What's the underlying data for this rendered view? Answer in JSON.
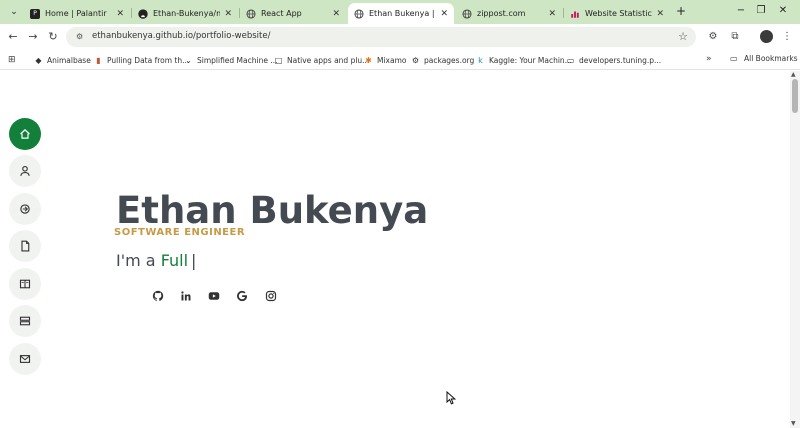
{
  "browser": {
    "tabs": [
      {
        "label": "Home | Palantir",
        "favicon": "palantir-icon",
        "active": false
      },
      {
        "label": "Ethan-Bukenya/memo",
        "favicon": "github-icon",
        "active": false
      },
      {
        "label": "React App",
        "favicon": "globe-icon",
        "active": false
      },
      {
        "label": "Ethan Bukenya | Portf",
        "favicon": "globe-icon",
        "active": true
      },
      {
        "label": "zippost.com",
        "favicon": "globe-icon",
        "active": false
      },
      {
        "label": "Website Statistics",
        "favicon": "stats-icon",
        "active": false
      }
    ],
    "address": "ethanbukenya.github.io/portfolio-website/",
    "bookmarks": [
      {
        "label": "Animalbase",
        "icon": "animal-icon"
      },
      {
        "label": "Pulling Data from th...",
        "icon": "page-icon"
      },
      {
        "label": "Simplified Machine ...",
        "icon": "chevron-icon"
      },
      {
        "label": "Native apps and plu...",
        "icon": "square-icon"
      },
      {
        "label": "Mixamo",
        "icon": "mixamo-icon"
      },
      {
        "label": "packages.org",
        "icon": "gear-icon"
      },
      {
        "label": "Kaggle: Your Machin...",
        "icon": "kaggle-icon"
      },
      {
        "label": "developers.tuning.p...",
        "icon": "page-icon"
      }
    ],
    "bookmarks_more": "»",
    "all_bookmarks": "All Bookmarks"
  },
  "hero": {
    "name": "Ethan Bukenya",
    "role": "SOFTWARE ENGINEER",
    "typing_prefix": "I'm a",
    "typing_word": "Full",
    "cursor": "|"
  },
  "side_nav": [
    {
      "name": "home-icon",
      "active": true
    },
    {
      "name": "user-icon",
      "active": false
    },
    {
      "name": "skills-icon",
      "active": false
    },
    {
      "name": "resume-icon",
      "active": false
    },
    {
      "name": "portfolio-icon",
      "active": false
    },
    {
      "name": "services-icon",
      "active": false
    },
    {
      "name": "mail-icon",
      "active": false
    }
  ],
  "socials": [
    "github-icon",
    "linkedin-icon",
    "youtube-icon",
    "google-icon",
    "instagram-icon"
  ],
  "colors": {
    "accent": "#12803a",
    "name_text": "#444a51",
    "role_text": "#c79a45",
    "tabstrip": "#cfe6c4"
  }
}
